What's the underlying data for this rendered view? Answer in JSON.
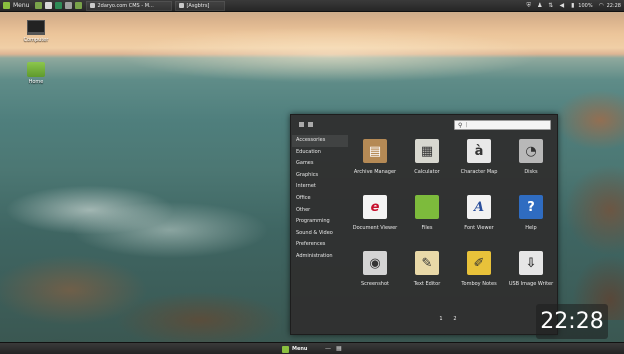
{
  "top_panel": {
    "menu_label": "Menu",
    "tasks": [
      {
        "label": "2daryo.com CMS - M..."
      },
      {
        "label": "[Asgbtrs]"
      }
    ],
    "tray": {
      "battery": "100%",
      "time": "22:28"
    }
  },
  "desktop": {
    "icons": [
      {
        "label": "Computer"
      },
      {
        "label": "Home"
      }
    ]
  },
  "app_menu": {
    "search": {
      "value": "",
      "placeholder": "|"
    },
    "categories": [
      {
        "label": "Accessories"
      },
      {
        "label": "Education"
      },
      {
        "label": "Games"
      },
      {
        "label": "Graphics"
      },
      {
        "label": "Internet"
      },
      {
        "label": "Office"
      },
      {
        "label": "Other"
      },
      {
        "label": "Programming"
      },
      {
        "label": "Sound & Video"
      },
      {
        "label": "Preferences"
      },
      {
        "label": "Administration"
      }
    ],
    "apps": [
      {
        "label": "Archive Manager",
        "icon": "archive-icon",
        "color": "#b58a55",
        "glyph": "▤"
      },
      {
        "label": "Calculator",
        "icon": "calculator-icon",
        "color": "#d8d8d0",
        "glyph": "▦"
      },
      {
        "label": "Character Map",
        "icon": "character-map-icon",
        "color": "#e8e8e8",
        "glyph": "à"
      },
      {
        "label": "Disks",
        "icon": "disks-icon",
        "color": "#b8b8b8",
        "glyph": "◔"
      },
      {
        "label": "Document Viewer",
        "icon": "document-viewer-icon",
        "color": "#f4f4f4",
        "glyph": "e"
      },
      {
        "label": "Files",
        "icon": "files-folder-icon",
        "color": "#7dbb3c",
        "glyph": ""
      },
      {
        "label": "Font Viewer",
        "icon": "font-viewer-icon",
        "color": "#f2f2f2",
        "glyph": "A"
      },
      {
        "label": "Help",
        "icon": "help-icon",
        "color": "#2f6cc1",
        "glyph": "?"
      },
      {
        "label": "Screenshot",
        "icon": "screenshot-icon",
        "color": "#d4d4d4",
        "glyph": "◉"
      },
      {
        "label": "Text Editor",
        "icon": "text-editor-icon",
        "color": "#e9d9a8",
        "glyph": "✎"
      },
      {
        "label": "Tomboy Notes",
        "icon": "tomboy-notes-icon",
        "color": "#e8c23a",
        "glyph": "✐"
      },
      {
        "label": "USB Image Writer",
        "icon": "usb-writer-icon",
        "color": "#e6e6e6",
        "glyph": "⇩"
      }
    ],
    "pages": [
      "1",
      "2"
    ]
  },
  "clock": {
    "time": "22:28"
  },
  "bottom_panel": {
    "menu_label": "Menu"
  }
}
